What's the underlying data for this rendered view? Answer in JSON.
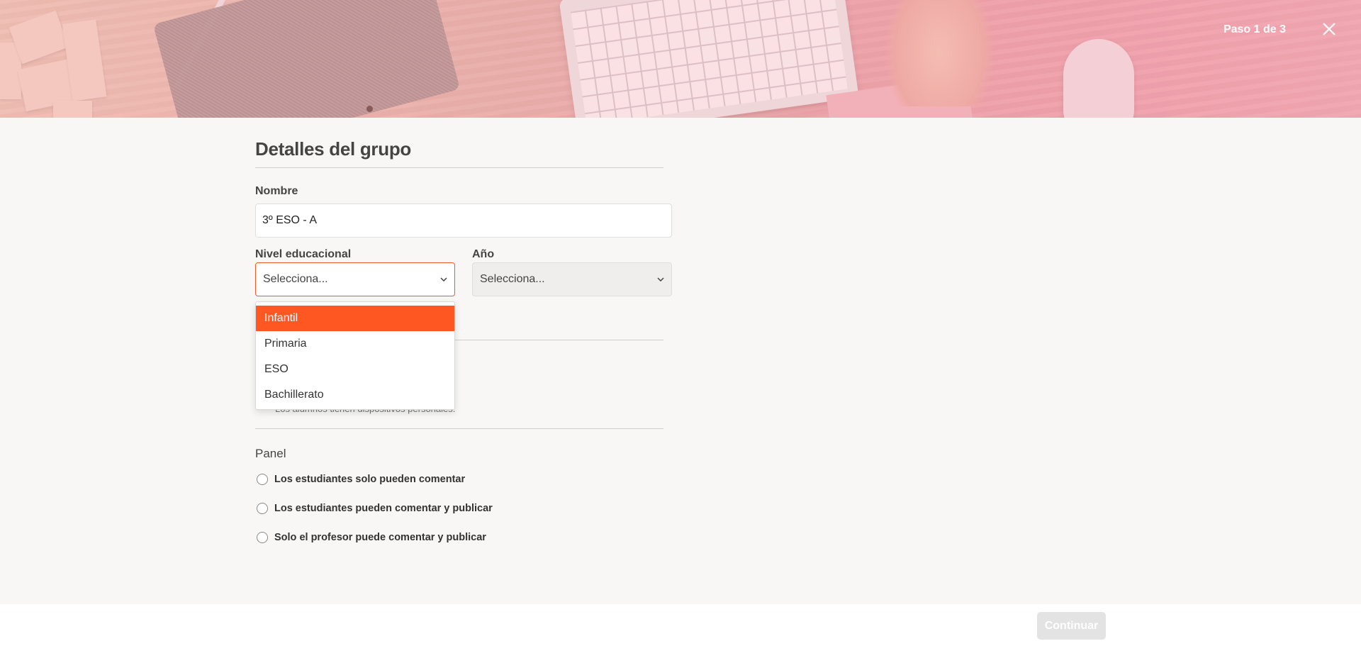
{
  "header": {
    "step": "Paso 1 de 3"
  },
  "form": {
    "title": "Detalles del grupo",
    "name_label": "Nombre",
    "name_value": "3º ESO - A",
    "level_label": "Nivel educacional",
    "level_value": "Selecciona...",
    "year_label": "Año",
    "year_value": "Selecciona...",
    "level_options": [
      "Infantil",
      "Primaria",
      "ESO",
      "Bachillerato"
    ],
    "devices_note": "Los alumnos tienen dispositivos personales.",
    "panel_title": "Panel",
    "panel_options": [
      "Los estudiantes solo pueden comentar",
      "Los estudiantes pueden comentar y publicar",
      "Solo el profesor puede comentar y publicar"
    ]
  },
  "footer": {
    "continue_label": "Continuar"
  },
  "colors": {
    "accent": "#ff5722",
    "focus_border": "#f05a28",
    "disabled_button": "#e3e3e3"
  }
}
